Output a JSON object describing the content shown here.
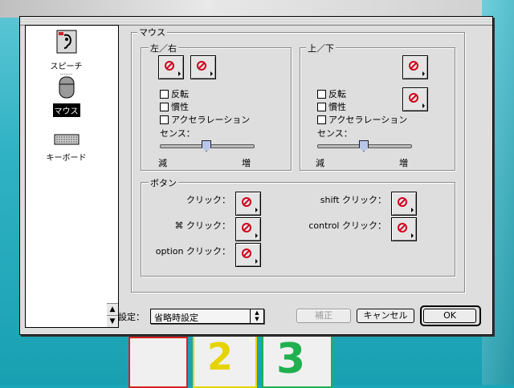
{
  "sidebar": {
    "items": [
      {
        "label": "スピーチ",
        "icon": "speech-ear-icon",
        "selected": false
      },
      {
        "label": "マウス",
        "icon": "mouse-icon",
        "selected": true
      },
      {
        "label": "キーボード",
        "icon": "keyboard-icon",
        "selected": false
      }
    ]
  },
  "mouse_panel": {
    "title": "マウス",
    "left_right": {
      "title": "左／右",
      "options": [
        "反転",
        "慣性",
        "アクセラレーション"
      ],
      "sense_label": "センス：",
      "min_label": "減",
      "max_label": "増",
      "sensitivity": 0.5
    },
    "up_down": {
      "title": "上／下",
      "options": [
        "反転",
        "慣性",
        "アクセラレーション"
      ],
      "sense_label": "センス：",
      "min_label": "減",
      "max_label": "増",
      "sensitivity": 0.5
    },
    "buttons": {
      "title": "ボタン",
      "click": "クリック：",
      "cmd_click": "⌘ クリック：",
      "option_click": "option クリック：",
      "shift_click": "shift クリック：",
      "control_click": "control クリック："
    }
  },
  "footer": {
    "settings_label": "設定：",
    "settings_value": "省略時設定",
    "apply_label": "補正",
    "cancel_label": "キャンセル",
    "ok_label": "OK"
  },
  "colors": {
    "no_symbol": "#d0001c",
    "desktop": "#1aa6b8"
  }
}
